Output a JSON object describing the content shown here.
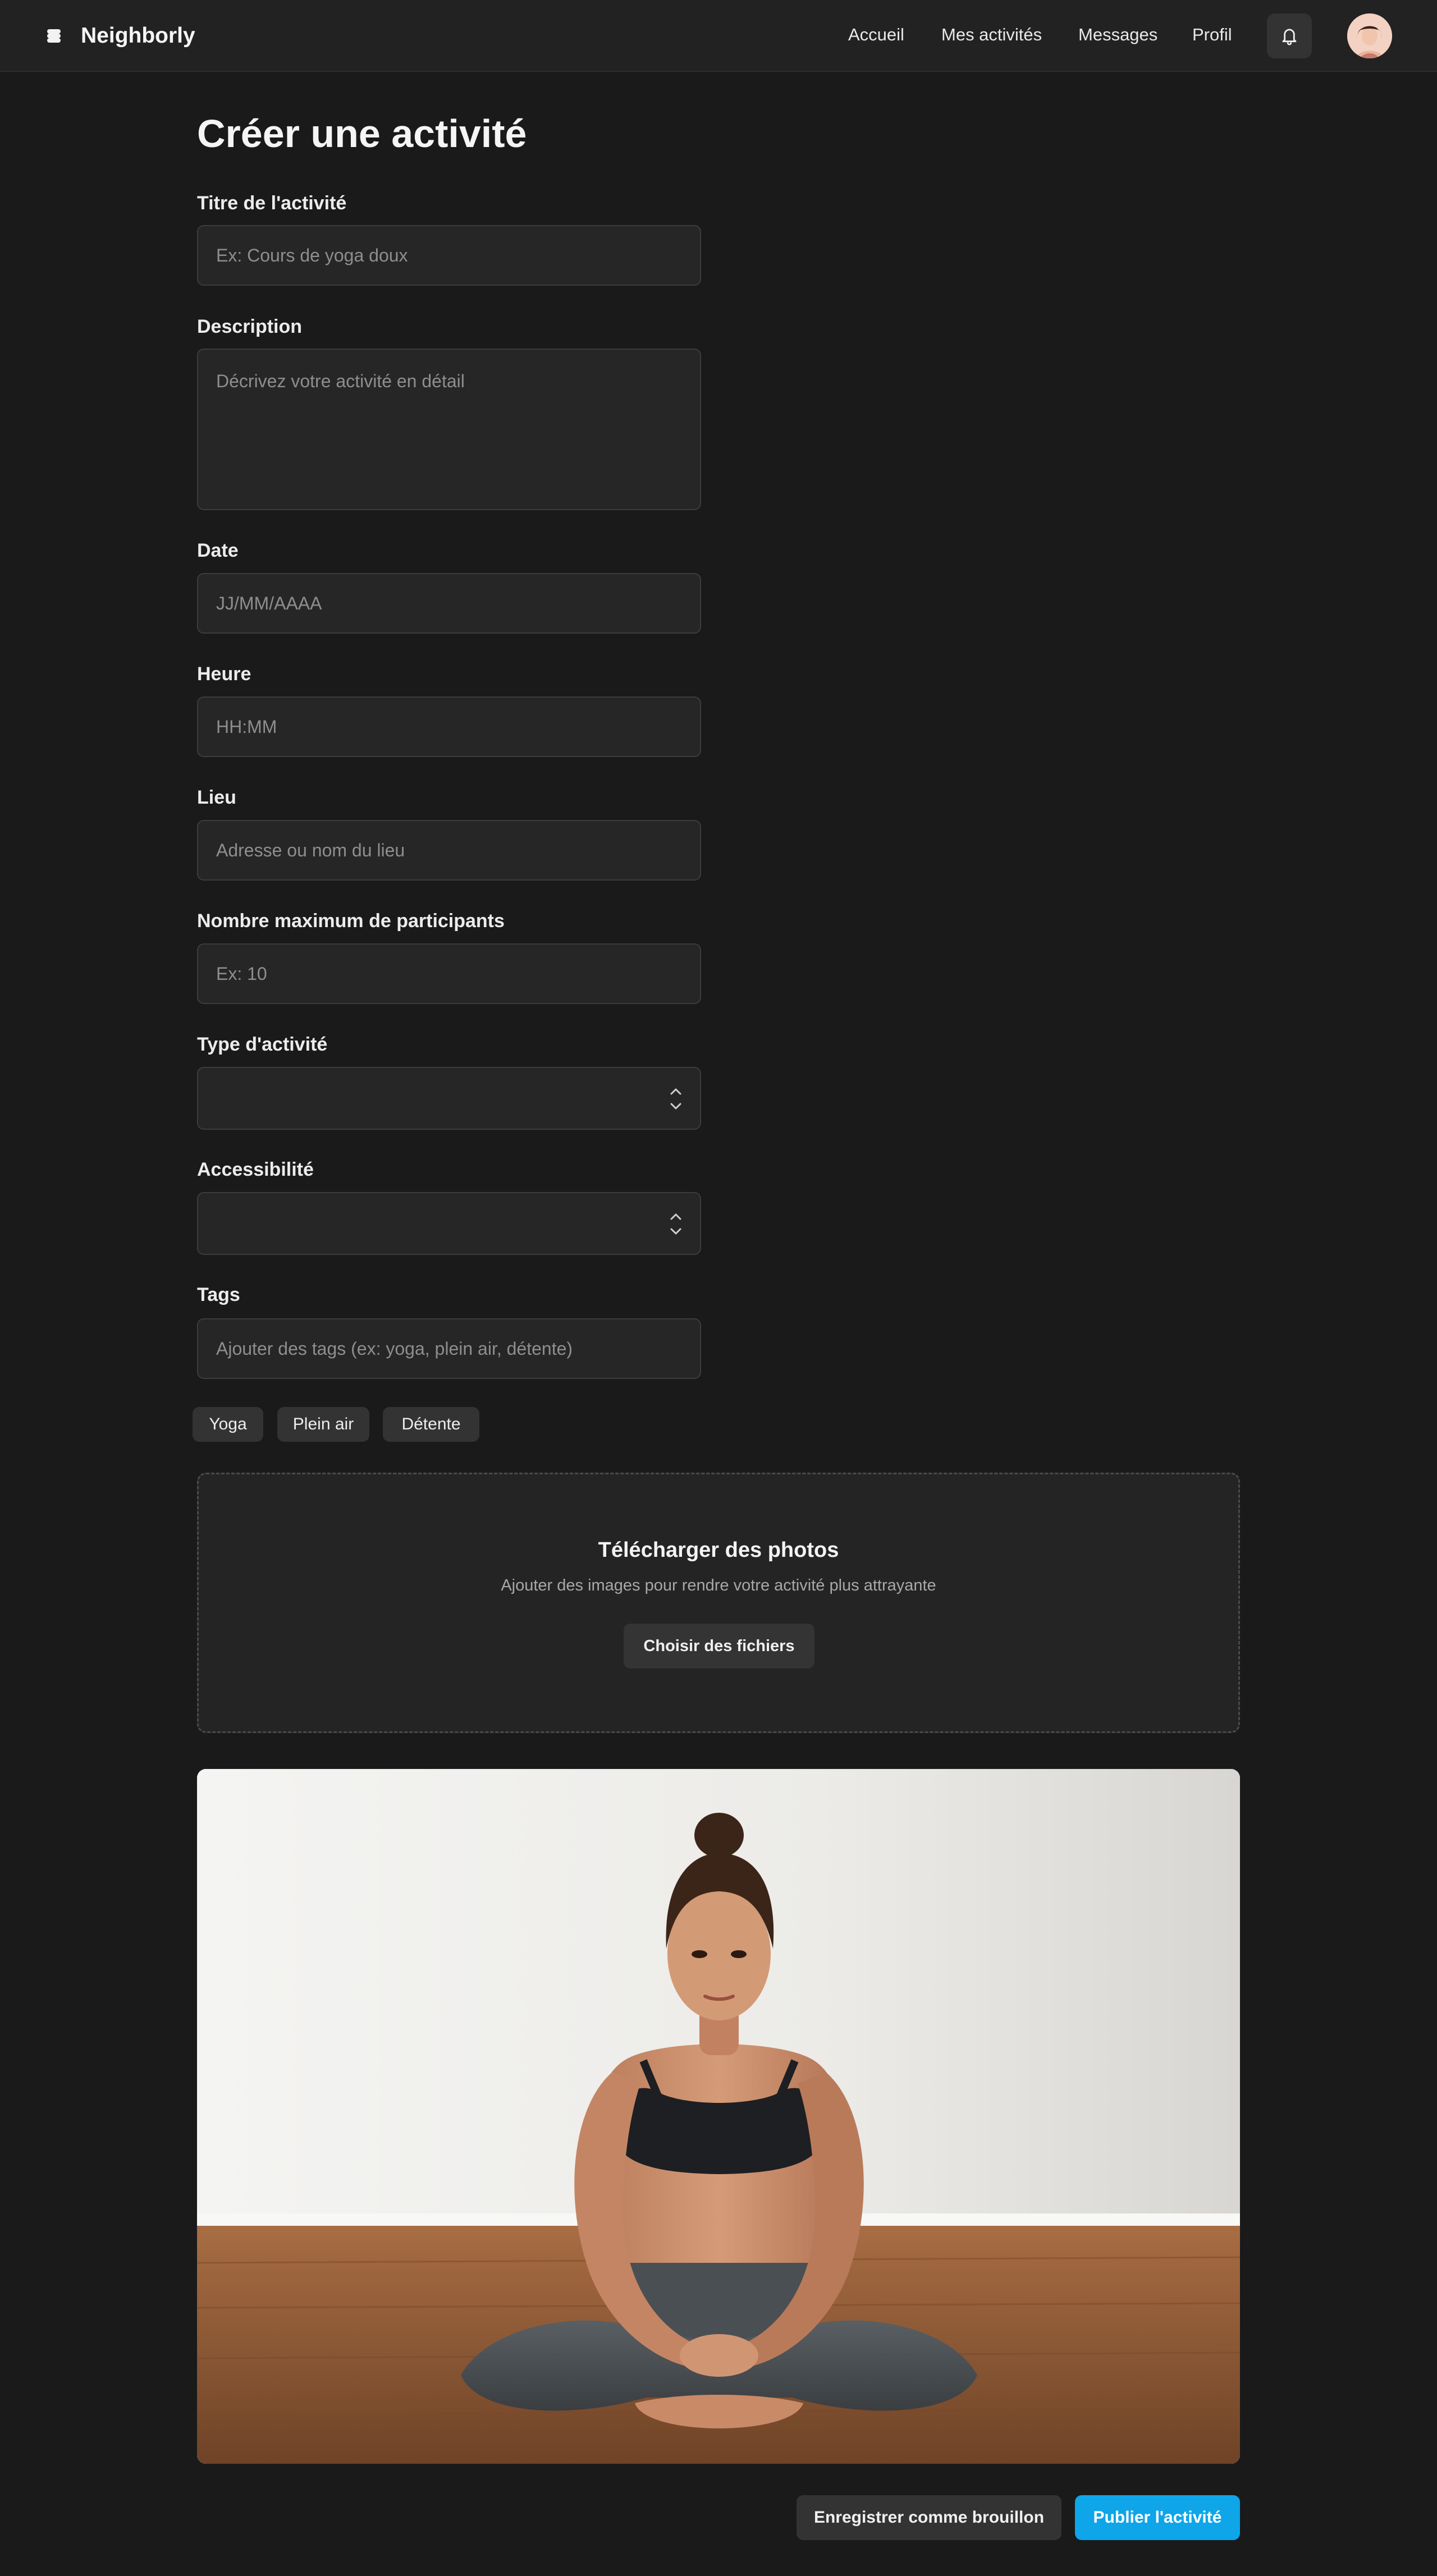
{
  "app": {
    "name": "Neighborly"
  },
  "nav": {
    "links": [
      "Accueil",
      "Mes activités",
      "Messages",
      "Profil"
    ],
    "icons": {
      "brand": "layers-icon",
      "notifications": "bell-icon"
    }
  },
  "page": {
    "title": "Créer une activité"
  },
  "form": {
    "title": {
      "label": "Titre de l'activité",
      "placeholder": "Ex: Cours de yoga doux",
      "value": ""
    },
    "description": {
      "label": "Description",
      "placeholder": "Décrivez votre activité en détail",
      "value": ""
    },
    "date": {
      "label": "Date",
      "placeholder": "JJ/MM/AAAA",
      "value": ""
    },
    "time": {
      "label": "Heure",
      "placeholder": "HH:MM",
      "value": ""
    },
    "location": {
      "label": "Lieu",
      "placeholder": "Adresse ou nom du lieu",
      "value": ""
    },
    "max_participants": {
      "label": "Nombre maximum de participants",
      "placeholder": "Ex: 10",
      "value": ""
    },
    "activity_type": {
      "label": "Type d'activité",
      "value": ""
    },
    "accessibility": {
      "label": "Accessibilité",
      "value": ""
    },
    "tags": {
      "label": "Tags",
      "placeholder": "Ajouter des tags (ex: yoga, plein air, détente)",
      "chips": [
        "Yoga",
        "Plein air",
        "Détente"
      ]
    }
  },
  "upload": {
    "title": "Télécharger des photos",
    "subtitle": "Ajouter des images pour rendre votre activité plus attrayante",
    "button": "Choisir des fichiers"
  },
  "actions": {
    "draft": "Enregistrer comme brouillon",
    "publish": "Publier l'activité"
  },
  "colors": {
    "background": "#1a1a1a",
    "surface": "#262626",
    "accent": "#0ea5e9"
  }
}
